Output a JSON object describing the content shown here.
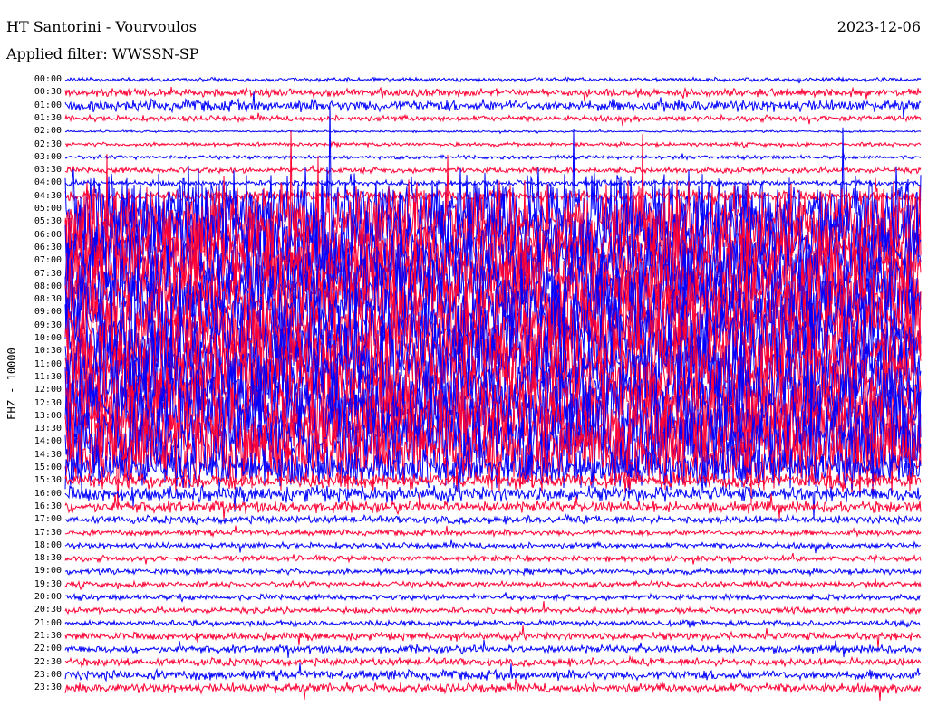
{
  "header": {
    "title": "HT Santorini - Vourvoulos",
    "filter": "Applied filter: WWSSN-SP",
    "date": "2023-12-06"
  },
  "chart_data": {
    "type": "line",
    "title": "HT Santorini - Vourvoulos",
    "ylabel": "EHZ - 10000",
    "row_labels": [
      "00:00",
      "00:30",
      "01:00",
      "01:30",
      "02:00",
      "02:30",
      "03:00",
      "03:30",
      "04:00",
      "04:30",
      "05:00",
      "05:30",
      "06:00",
      "06:30",
      "07:00",
      "07:30",
      "08:00",
      "08:30",
      "09:00",
      "09:30",
      "10:00",
      "10:30",
      "11:00",
      "11:30",
      "12:00",
      "12:30",
      "13:00",
      "13:30",
      "14:00",
      "14:30",
      "15:00",
      "15:30",
      "16:00",
      "16:30",
      "17:00",
      "17:30",
      "18:00",
      "18:30",
      "19:00",
      "19:30",
      "20:00",
      "20:30",
      "21:00",
      "21:30",
      "22:00",
      "22:30",
      "23:00",
      "23:30"
    ],
    "row_activity": [
      2,
      4,
      6,
      3,
      1,
      2,
      2,
      3,
      3,
      6,
      40,
      40,
      40,
      40,
      40,
      40,
      40,
      40,
      40,
      40,
      40,
      40,
      40,
      40,
      40,
      40,
      40,
      40,
      40,
      40,
      20,
      8,
      8,
      6,
      4,
      3,
      3,
      3,
      3,
      3,
      3,
      3,
      3,
      4,
      4,
      4,
      5,
      5
    ],
    "series_colors": [
      "#0000ff",
      "#ff0033"
    ],
    "grid": false
  }
}
